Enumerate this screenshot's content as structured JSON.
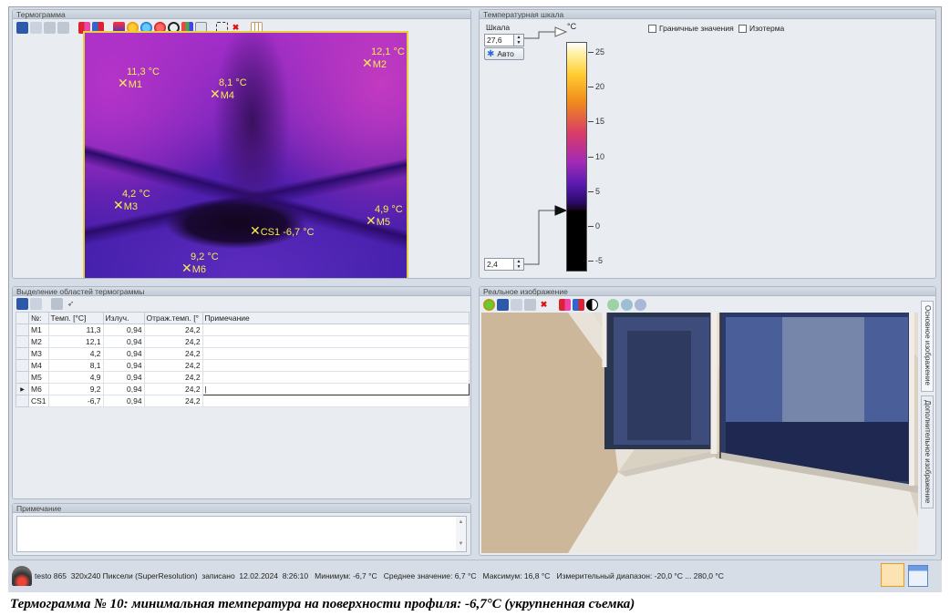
{
  "thermogram_panel": {
    "title": "Термограмма",
    "toolbar_icons": [
      "save-icon",
      "copy-icon",
      "paste-icon",
      "export-icon",
      "marker-add-icon",
      "marker-remove-icon",
      "palette-icon",
      "circle-orange-icon",
      "circle-blue-icon",
      "circle-red-icon",
      "no-icon",
      "histogram-icon",
      "profile-icon",
      "select-area-icon",
      "delete-icon",
      "grid-icon"
    ],
    "markers": [
      {
        "id": "M1",
        "temp": "11,3 °C"
      },
      {
        "id": "M2",
        "temp": "12,1 °C"
      },
      {
        "id": "M3",
        "temp": "4,2 °C"
      },
      {
        "id": "M4",
        "temp": "8,1 °C"
      },
      {
        "id": "M5",
        "temp": "4,9 °C"
      },
      {
        "id": "M6",
        "temp": "9,2 °C"
      },
      {
        "id": "CS1",
        "temp": "-6,7 °C"
      }
    ]
  },
  "scale_panel": {
    "title": "Температурная шкала",
    "scale_label": "Шкала",
    "max_value": "27,6",
    "min_value": "2,4",
    "auto_button": "Авто",
    "unit": "°C",
    "ticks": [
      "25",
      "20",
      "15",
      "10",
      "5",
      "0",
      "-5"
    ],
    "limit_values_label": "Граничные значения",
    "isotherm_label": "Изотерма",
    "limit_values_checked": false,
    "isotherm_checked": false
  },
  "areas_panel": {
    "title": "Выделение областей термограммы",
    "columns": [
      "№:",
      "Темп. [°C]",
      "Излуч.",
      "Отраж.темп. [°",
      "Примечание"
    ],
    "rows": [
      {
        "id": "M1",
        "temp": "11,3",
        "emis": "0,94",
        "refl": "24,2",
        "note": ""
      },
      {
        "id": "M2",
        "temp": "12,1",
        "emis": "0,94",
        "refl": "24,2",
        "note": ""
      },
      {
        "id": "M3",
        "temp": "4,2",
        "emis": "0,94",
        "refl": "24,2",
        "note": ""
      },
      {
        "id": "M4",
        "temp": "8,1",
        "emis": "0,94",
        "refl": "24,2",
        "note": ""
      },
      {
        "id": "M5",
        "temp": "4,9",
        "emis": "0,94",
        "refl": "24,2",
        "note": ""
      },
      {
        "id": "M6",
        "temp": "9,2",
        "emis": "0,94",
        "refl": "24,2",
        "note": "|"
      },
      {
        "id": "CS1",
        "temp": "-6,7",
        "emis": "0,94",
        "refl": "24,2",
        "note": ""
      }
    ],
    "current_row": "M6"
  },
  "note_panel": {
    "title": "Примечание",
    "value": ""
  },
  "photo_panel": {
    "title": "Реальное изображение",
    "tabs": [
      "Основное изображение",
      "Дополнительное изображение"
    ]
  },
  "status_bar": {
    "text": "testo 865  320x240 Пиксели (SuperResolution)  записано  12.02.2024  8:26:10   Минимум: -6,7 °C   Среднее значение: 6,7 °C   Максимум: 16,8 °C   Измерительный диапазон: -20,0 °C ... 280,0 °C"
  },
  "caption": "Термограмма № 10: минимальная температура на поверхности профиля: -6,7°C (укрупненная съемка)"
}
